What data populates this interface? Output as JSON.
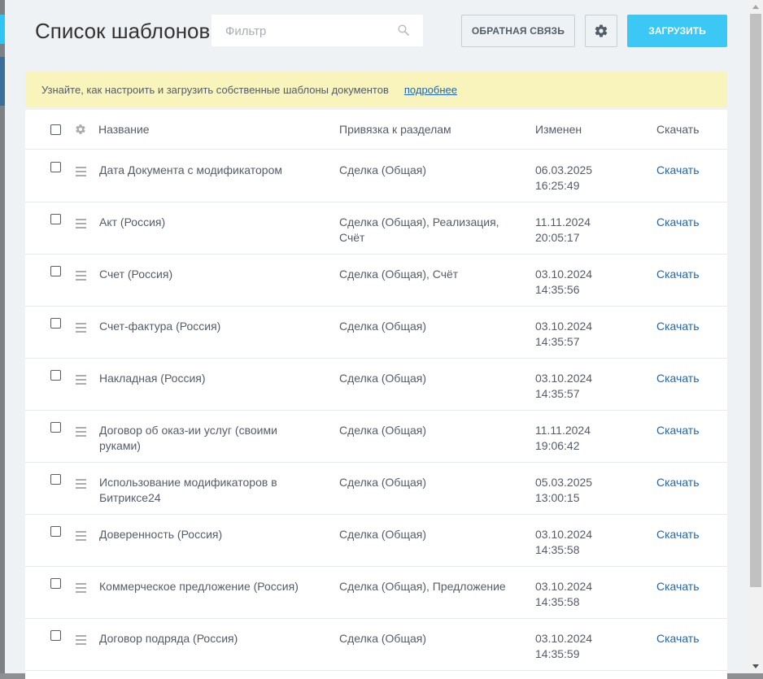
{
  "header": {
    "title": "Список шаблонов",
    "search_placeholder": "Фильтр",
    "feedback_label": "ОБРАТНАЯ СВЯЗЬ",
    "upload_label": "ЗАГРУЗИТЬ"
  },
  "banner": {
    "text": "Узнайте, как настроить и загрузить собственные шаблоны документов",
    "link": "подробнее"
  },
  "columns": {
    "name": "Название",
    "sections": "Привязка к разделам",
    "modified": "Изменен",
    "download": "Скачать"
  },
  "rows": [
    {
      "name_1": "Дата Документа с модификатором",
      "name_2": "",
      "sections_1": "Сделка (Общая)",
      "sections_2": "",
      "date": "06.03.2025",
      "time": "16:25:49",
      "download": "Скачать"
    },
    {
      "name_1": "Акт (Россия)",
      "name_2": "",
      "sections_1": "Сделка (Общая), Реализация,",
      "sections_2": "Счёт",
      "date": "11.11.2024",
      "time": "20:05:17",
      "download": "Скачать"
    },
    {
      "name_1": "Счет (Россия)",
      "name_2": "",
      "sections_1": "Сделка (Общая), Счёт",
      "sections_2": "",
      "date": "03.10.2024",
      "time": "14:35:56",
      "download": "Скачать"
    },
    {
      "name_1": "Счет-фактура (Россия)",
      "name_2": "",
      "sections_1": "Сделка (Общая)",
      "sections_2": "",
      "date": "03.10.2024",
      "time": "14:35:57",
      "download": "Скачать"
    },
    {
      "name_1": "Накладная (Россия)",
      "name_2": "",
      "sections_1": "Сделка (Общая)",
      "sections_2": "",
      "date": "03.10.2024",
      "time": "14:35:57",
      "download": "Скачать"
    },
    {
      "name_1": "Договор об оказ-ии услуг (своими",
      "name_2": "руками)",
      "sections_1": "Сделка (Общая)",
      "sections_2": "",
      "date": "11.11.2024",
      "time": "19:06:42",
      "download": "Скачать"
    },
    {
      "name_1": "Использование модификаторов в",
      "name_2": "Битриксе24",
      "sections_1": "Сделка (Общая)",
      "sections_2": "",
      "date": "05.03.2025",
      "time": "13:00:15",
      "download": "Скачать"
    },
    {
      "name_1": "Доверенность (Россия)",
      "name_2": "",
      "sections_1": "Сделка (Общая)",
      "sections_2": "",
      "date": "03.10.2024",
      "time": "14:35:58",
      "download": "Скачать"
    },
    {
      "name_1": "Коммерческое предложение (Россия)",
      "name_2": "",
      "sections_1": "Сделка (Общая), Предложение",
      "sections_2": "",
      "date": "03.10.2024",
      "time": "14:35:58",
      "download": "Скачать"
    },
    {
      "name_1": "Договор подряда (Россия)",
      "name_2": "",
      "sections_1": "Сделка (Общая)",
      "sections_2": "",
      "date": "03.10.2024",
      "time": "14:35:59",
      "download": "Скачать"
    }
  ],
  "icons": {
    "search": "search-icon",
    "gear": "gear-icon",
    "drag": "drag-handle-icon"
  },
  "colors": {
    "accent": "#3bc8f5",
    "link": "#2067b0",
    "banner": "#f8f4bc"
  }
}
